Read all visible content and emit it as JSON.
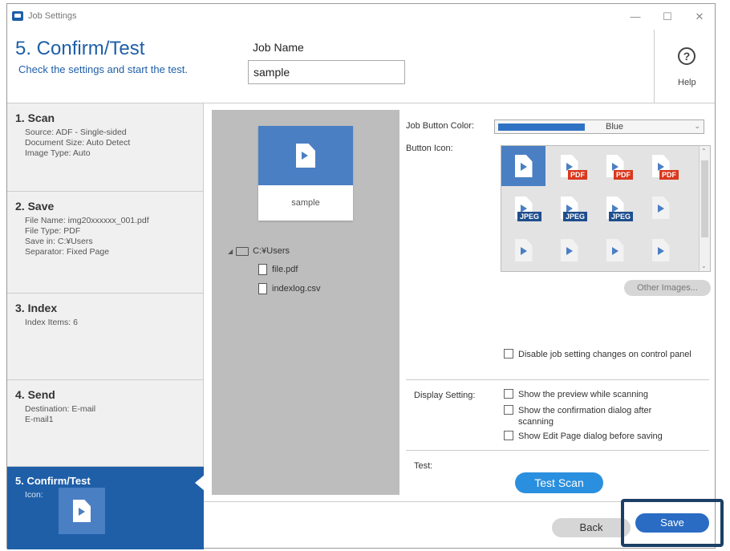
{
  "window": {
    "title": "Job Settings",
    "minimize": "—",
    "maximize": "☐",
    "close": "✕"
  },
  "header": {
    "step_title": "5. Confirm/Test",
    "step_subtitle": "Check the settings and start the test.",
    "job_name_label": "Job Name",
    "job_name_value": "sample",
    "help_glyph": "?",
    "help_label": "Help"
  },
  "steps": [
    {
      "title": "1. Scan",
      "lines": [
        "Source: ADF - Single-sided",
        "Document Size: Auto Detect",
        "Image Type: Auto"
      ]
    },
    {
      "title": "2. Save",
      "lines": [
        "File Name: img20xxxxxx_001.pdf",
        "File Type: PDF",
        "Save in: C:¥Users",
        "Separator: Fixed Page"
      ]
    },
    {
      "title": "3. Index",
      "lines": [
        "Index Items: 6"
      ]
    },
    {
      "title": "4. Send",
      "lines": [
        "Destination: E-mail",
        "E-mail1"
      ]
    },
    {
      "title": "5. Confirm/Test",
      "lines": [
        "Icon:"
      ]
    }
  ],
  "preview": {
    "card_label": "sample",
    "tree": {
      "folder": "C:¥Users",
      "files": [
        "file.pdf",
        "indexlog.csv"
      ]
    }
  },
  "settings": {
    "job_button_color_label": "Job Button Color:",
    "job_button_color_value": "Blue",
    "job_button_color_hex": "#2f72c4",
    "button_icon_label": "Button Icon:",
    "icon_tags": {
      "pdf": "PDF",
      "jpeg": "JPEG"
    },
    "other_images_label": "Other Images...",
    "disable_changes_label": "Disable job setting changes on control panel",
    "display_setting_label": "Display Setting:",
    "display_options": [
      "Show the preview while scanning",
      "Show the confirmation dialog after scanning",
      "Show Edit Page dialog before saving"
    ],
    "test_label": "Test:",
    "test_scan_label": "Test Scan"
  },
  "footer": {
    "back_label": "Back",
    "save_label": "Save"
  },
  "colors": {
    "accent": "#1f5fa8",
    "icon_blue": "#4a7fc3",
    "test_button": "#2a8fde",
    "highlight_frame": "#1b3f66"
  }
}
